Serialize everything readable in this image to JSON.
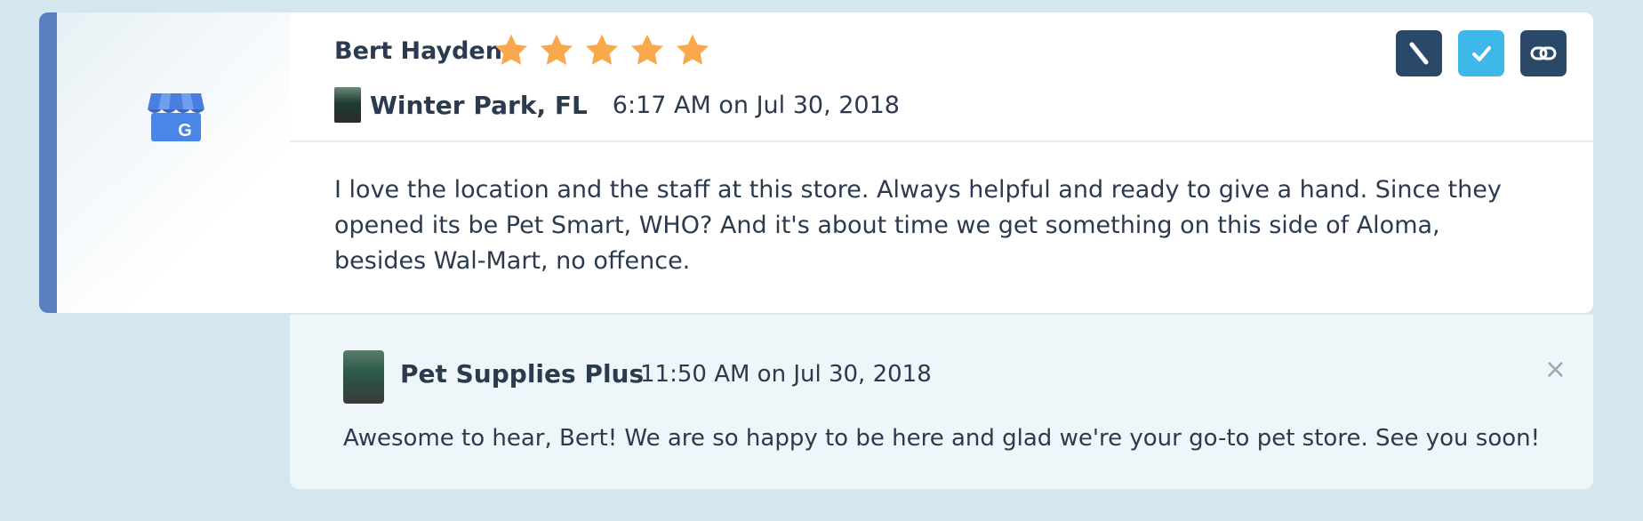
{
  "review": {
    "reviewer_name": "Bert Hayden",
    "rating": 5,
    "rating_max": 5,
    "location": "Winter Park, FL",
    "timestamp": "6:17 AM on Jul 30, 2018",
    "body": "I love the location and the staff at this store. Always helpful and ready to give a hand. Since they opened its be Pet Smart, WHO? And it's about time we get something on this side of Aloma, besides Wal-Mart, no offence.",
    "source_icon": "google-my-business-icon",
    "actions": [
      {
        "name": "edit-button",
        "icon": "pencil-icon"
      },
      {
        "name": "mark-done-button",
        "icon": "check-icon"
      },
      {
        "name": "link-button",
        "icon": "link-icon"
      }
    ]
  },
  "reply": {
    "author": "Pet Supplies Plus",
    "timestamp": "11:50 AM on Jul 30, 2018",
    "text": "Awesome to hear, Bert! We are so happy to be here and glad we're your go-to pet store. See you soon!",
    "close_symbol": "×"
  },
  "colors": {
    "background": "#d4e7ee",
    "accent_bar": "#5a7ec0",
    "star": "#f7a94b",
    "button_dark": "#2a4868",
    "button_light": "#3db8e8",
    "text": "#2b3a4f"
  }
}
